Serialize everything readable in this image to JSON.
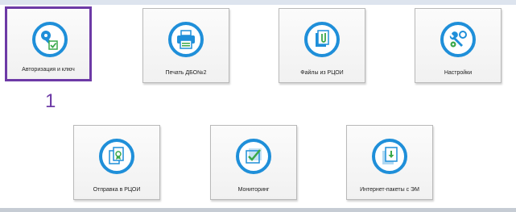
{
  "tiles": [
    {
      "label": "Авторизация и ключ",
      "icon": "key-check-icon",
      "selected": true
    },
    {
      "label": "Печать ДБО№2",
      "icon": "printer-icon"
    },
    {
      "label": "Файлы из РЦОИ",
      "icon": "file-clip-icon"
    },
    {
      "label": "Настройки",
      "icon": "tools-icon"
    },
    {
      "label": "Отправка в РЦОИ",
      "icon": "send-documents-icon"
    },
    {
      "label": "Мониторинг",
      "icon": "monitoring-check-icon"
    },
    {
      "label": "Интернет-пакеты с ЭМ",
      "icon": "download-package-icon"
    }
  ],
  "annotation": {
    "marker": "1"
  },
  "colors": {
    "accent": "#1f8fd9",
    "highlight": "#6d3aa6",
    "icon_green": "#3aa84a"
  }
}
